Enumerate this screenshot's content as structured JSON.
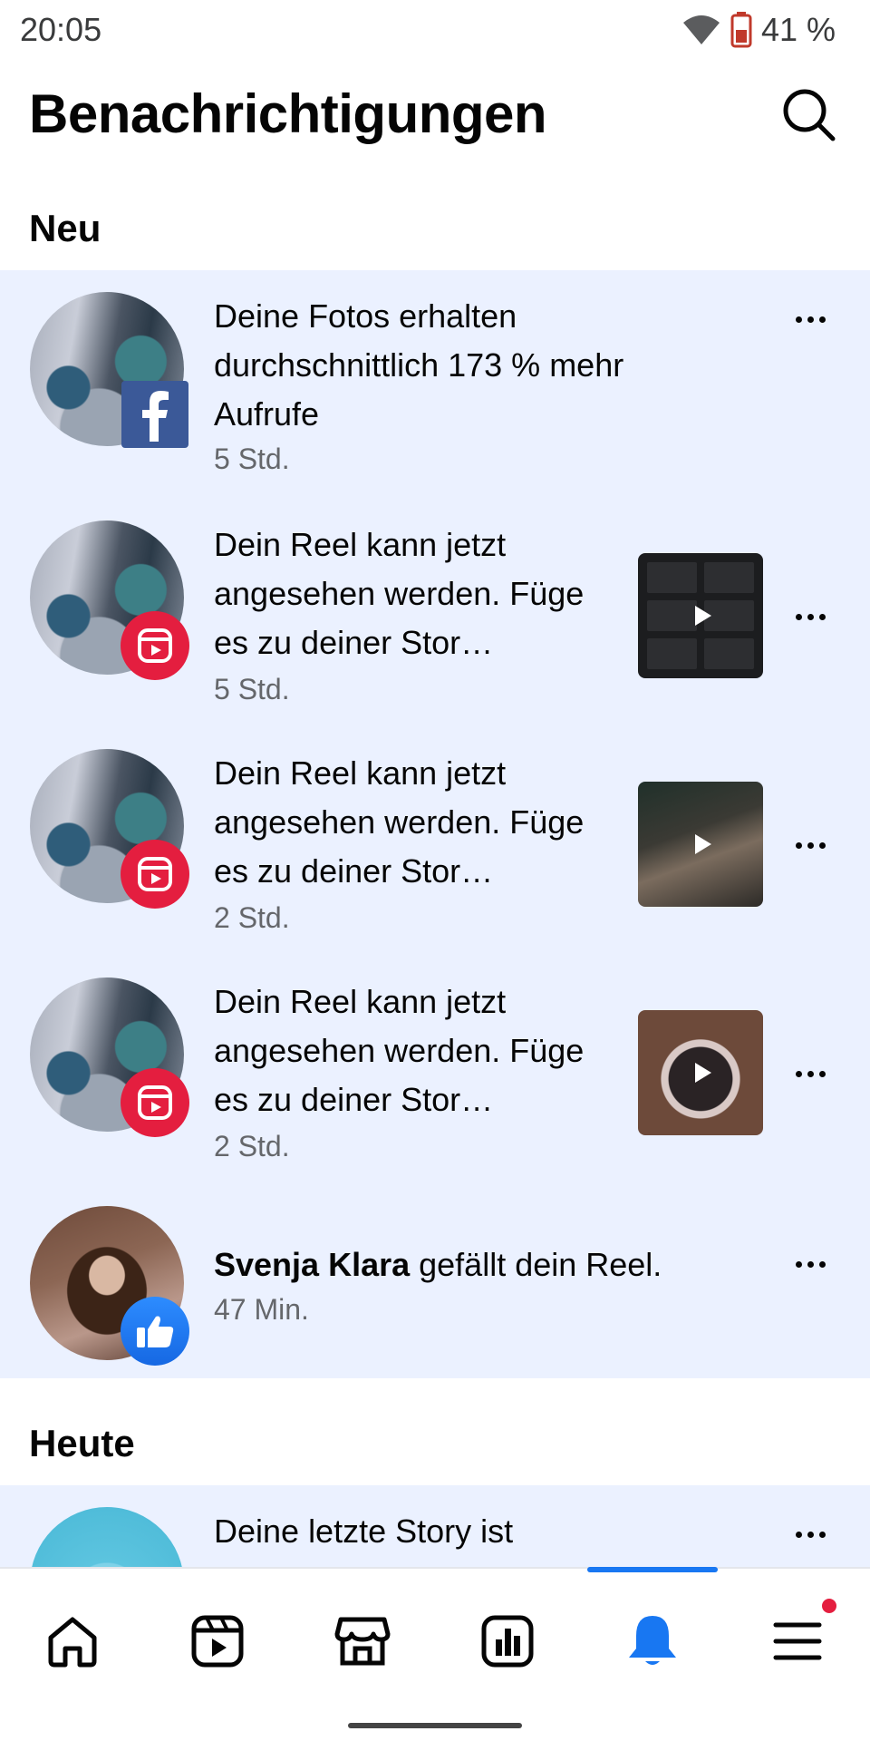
{
  "status_bar": {
    "time": "20:05",
    "battery": "41 %"
  },
  "header": {
    "title": "Benachrichtigungen"
  },
  "sections": {
    "new": "Neu",
    "today": "Heute"
  },
  "notifications_new": [
    {
      "text": "Deine Fotos erhalten durchschnittlich 173 % mehr Aufrufe",
      "time": "5 Std.",
      "badge": "facebook-icon"
    },
    {
      "text": "Dein Reel kann jetzt angesehen werden. Füge es zu deiner Stor…",
      "time": "5 Std.",
      "badge": "reels-icon"
    },
    {
      "text": "Dein Reel kann jetzt angesehen werden. Füge es zu deiner Stor…",
      "time": "2 Std.",
      "badge": "reels-icon"
    },
    {
      "text": "Dein Reel kann jetzt angesehen werden. Füge es zu deiner Stor…",
      "time": "2 Std.",
      "badge": "reels-icon"
    },
    {
      "actor": "Svenja Klara",
      "text": " gefällt dein Reel.",
      "time": "47 Min.",
      "badge": "like-icon"
    }
  ],
  "notifications_today": [
    {
      "text": "Deine letzte Story ist abgelaufen."
    }
  ],
  "bottom_nav": [
    "home-icon",
    "reels-icon",
    "marketplace-icon",
    "dashboard-icon",
    "notifications-bell-icon",
    "menu-icon"
  ],
  "colors": {
    "accent": "#1877f2",
    "unread_bg": "#ebf1ff",
    "reel_badge": "#e41e3f"
  }
}
